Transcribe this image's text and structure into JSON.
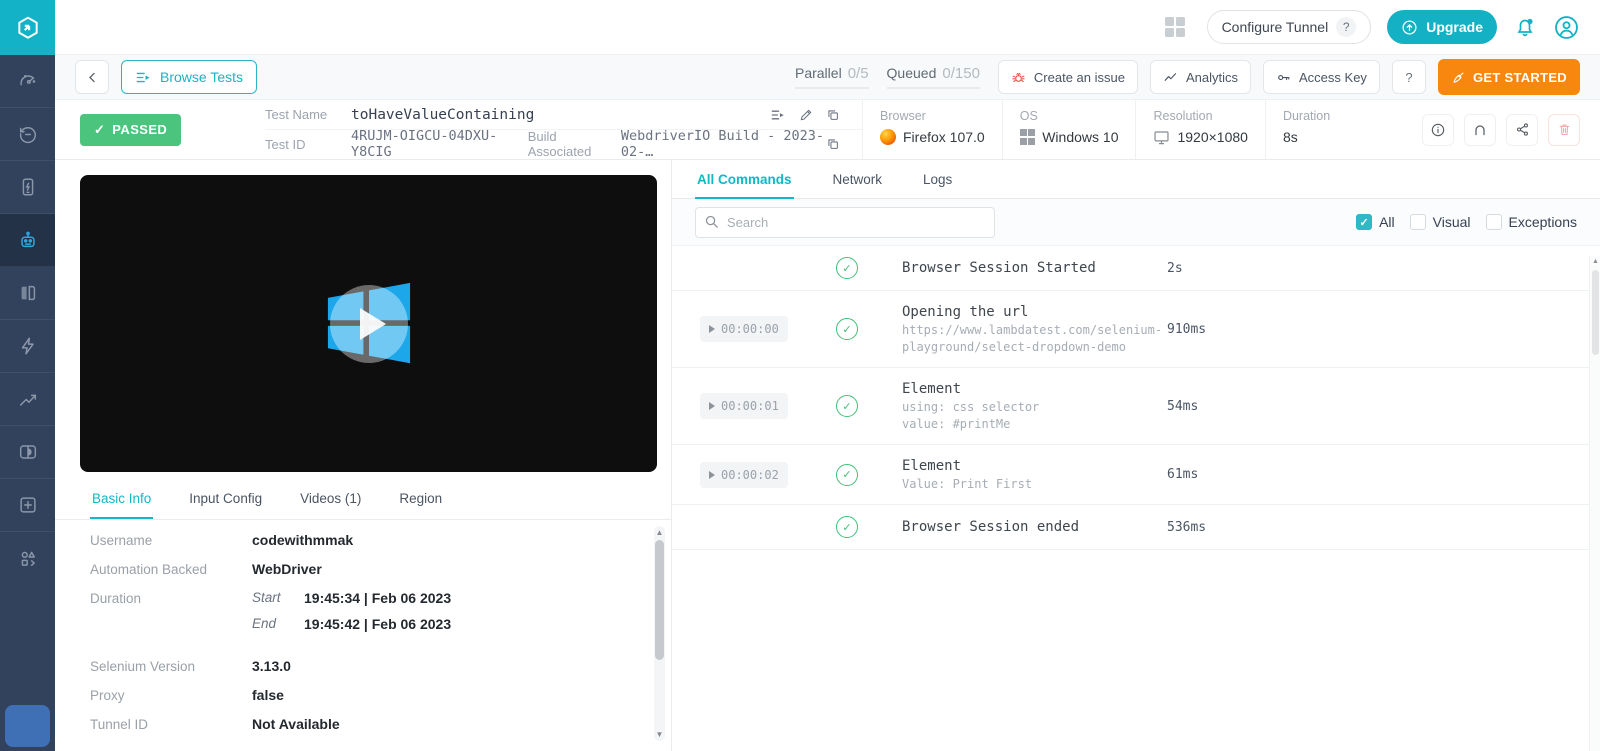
{
  "colors": {
    "teal": "#0EBAC5",
    "orange": "#F7870F",
    "green": "#4BC47D",
    "sidebar": "#32415C",
    "active_icon": "#2EA9E0"
  },
  "topbar": {
    "configure_tunnel": "Configure Tunnel",
    "configure_help": "?",
    "upgrade": "Upgrade"
  },
  "toolbar": {
    "browse_tests": "Browse Tests",
    "parallel_label": "Parallel",
    "parallel_value": "0/5",
    "queued_label": "Queued",
    "queued_value": "0/150",
    "create_issue": "Create an issue",
    "analytics": "Analytics",
    "access_key": "Access Key",
    "help": "?",
    "get_started": "GET STARTED"
  },
  "test": {
    "status": "PASSED",
    "status_check": "✓",
    "name_label": "Test Name",
    "name": "toHaveValueContaining",
    "id_label": "Test ID",
    "id": "4RUJM-OIGCU-04DXU-Y8CIG",
    "build_label": "Build Associated",
    "build": "WebdriverIO Build - 2023-02-…",
    "env": [
      {
        "label": "Browser",
        "value": "Firefox 107.0"
      },
      {
        "label": "OS",
        "value": "Windows 10"
      },
      {
        "label": "Resolution",
        "value": "1920×1080"
      },
      {
        "label": "Duration",
        "value": "8s"
      }
    ]
  },
  "left_tabs": [
    {
      "label": "Basic Info"
    },
    {
      "label": "Input Config"
    },
    {
      "label": "Videos (1)"
    },
    {
      "label": "Region"
    }
  ],
  "details": {
    "username_label": "Username",
    "username": "codewithmmak",
    "automation_label": "Automation Backed",
    "automation": "WebDriver",
    "duration_label": "Duration",
    "start_label": "Start",
    "start_value": "19:45:34 | Feb 06 2023",
    "end_label": "End",
    "end_value": "19:45:42 | Feb 06 2023",
    "selenium_label": "Selenium Version",
    "selenium": "3.13.0",
    "proxy_label": "Proxy",
    "proxy": "false",
    "tunnel_label": "Tunnel ID",
    "tunnel": "Not Available"
  },
  "right_tabs": [
    {
      "label": "All Commands"
    },
    {
      "label": "Network"
    },
    {
      "label": "Logs"
    }
  ],
  "search_placeholder": "Search",
  "filters": [
    {
      "label": "All",
      "checked": true
    },
    {
      "label": "Visual",
      "checked": false
    },
    {
      "label": "Exceptions",
      "checked": false
    }
  ],
  "commands": [
    {
      "time": "",
      "title": "Browser Session Started",
      "duration": "2s"
    },
    {
      "time": "00:00:00",
      "title": "Opening the url",
      "line1": "https://www.lambdatest.com/selenium-playground/select-dropdown-demo",
      "duration": "910ms"
    },
    {
      "time": "00:00:01",
      "title": "Element",
      "line1": "using: css selector",
      "line2": "value: #printMe",
      "duration": "54ms"
    },
    {
      "time": "00:00:02",
      "title": "Element",
      "line1": "Value: Print First",
      "duration": "61ms"
    },
    {
      "time": "",
      "title": "Browser Session ended",
      "duration": "536ms"
    }
  ]
}
